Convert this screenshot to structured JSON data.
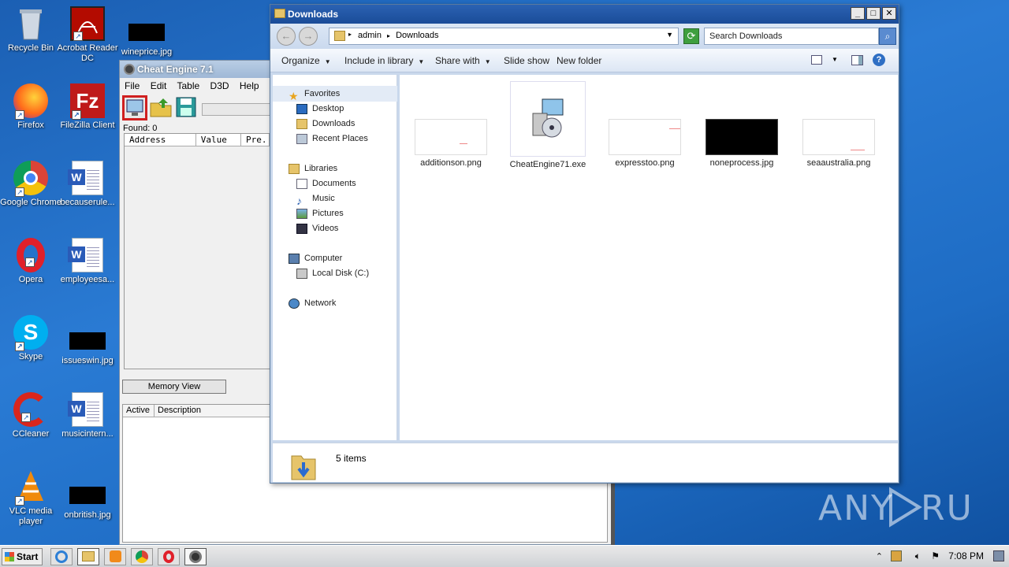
{
  "desktop": {
    "icons": [
      {
        "label": "Recycle Bin"
      },
      {
        "label": "Acrobat Reader DC"
      },
      {
        "label": "wineprice.jpg"
      },
      {
        "label": "Firefox"
      },
      {
        "label": "FileZilla Client"
      },
      {
        "label": "Google Chrome"
      },
      {
        "label": "becauserule..."
      },
      {
        "label": "Opera"
      },
      {
        "label": "employeesa..."
      },
      {
        "label": "Skype"
      },
      {
        "label": "issueswin.jpg"
      },
      {
        "label": "CCleaner"
      },
      {
        "label": "musicintern..."
      },
      {
        "label": "VLC media player"
      },
      {
        "label": "onbritish.jpg"
      }
    ]
  },
  "cheat_engine": {
    "title": "Cheat Engine 7.1",
    "menu": [
      "File",
      "Edit",
      "Table",
      "D3D",
      "Help"
    ],
    "found_label": "Found: 0",
    "list_columns": [
      "Address",
      "Value",
      "Pre."
    ],
    "memory_view_label": "Memory View",
    "table_columns": [
      "Active",
      "Description"
    ]
  },
  "explorer": {
    "title": "Downloads",
    "breadcrumb": [
      "admin",
      "Downloads"
    ],
    "search_placeholder": "Search Downloads",
    "commands": [
      "Organize",
      "Include in library",
      "Share with",
      "Slide show",
      "New folder"
    ],
    "nav": {
      "favorites": "Favorites",
      "desktop": "Desktop",
      "downloads": "Downloads",
      "recent": "Recent Places",
      "libraries": "Libraries",
      "documents": "Documents",
      "music": "Music",
      "pictures": "Pictures",
      "videos": "Videos",
      "computer": "Computer",
      "local_disk": "Local Disk (C:)",
      "network": "Network"
    },
    "files": [
      {
        "name": "additionson.png"
      },
      {
        "name": "CheatEngine71.exe"
      },
      {
        "name": "expresstoo.png"
      },
      {
        "name": "noneprocess.jpg"
      },
      {
        "name": "seaaustralia.png"
      }
    ],
    "status": "5 items"
  },
  "taskbar": {
    "start_label": "Start",
    "clock": "7:08 PM"
  },
  "watermark": "ANY RUN"
}
